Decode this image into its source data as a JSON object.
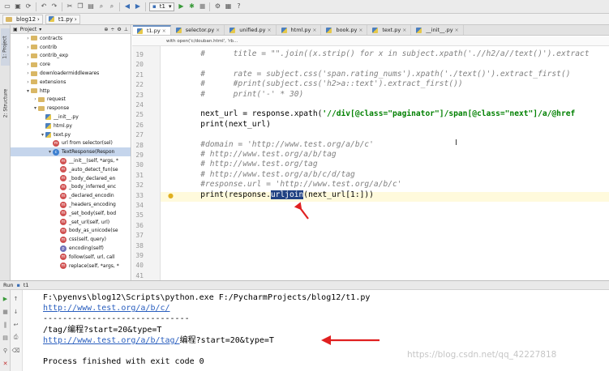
{
  "toolbar": {
    "run_config_label": "t1"
  },
  "navbar": {
    "crumbs": [
      "blog12",
      "t1.py"
    ]
  },
  "left_strip": {
    "project_tab": "1: Project",
    "structure_tab": "2: Structure"
  },
  "project_panel": {
    "title": "Project",
    "items": [
      {
        "label": "contracts",
        "kind": "folder",
        "depth": 2,
        "expanded": false
      },
      {
        "label": "contrib",
        "kind": "folder",
        "depth": 2,
        "expanded": false
      },
      {
        "label": "contrib_exp",
        "kind": "folder",
        "depth": 2,
        "expanded": false
      },
      {
        "label": "core",
        "kind": "folder",
        "depth": 2,
        "expanded": false
      },
      {
        "label": "downloadermiddlewares",
        "kind": "folder",
        "depth": 2,
        "expanded": false
      },
      {
        "label": "extensions",
        "kind": "folder",
        "depth": 2,
        "expanded": false
      },
      {
        "label": "http",
        "kind": "folder",
        "depth": 2,
        "expanded": true
      },
      {
        "label": "request",
        "kind": "folder",
        "depth": 3,
        "expanded": false
      },
      {
        "label": "response",
        "kind": "folder",
        "depth": 3,
        "expanded": true
      },
      {
        "label": "__init__.py",
        "kind": "py",
        "depth": 4
      },
      {
        "label": "html.py",
        "kind": "py",
        "depth": 4
      },
      {
        "label": "text.py",
        "kind": "py",
        "depth": 4,
        "expanded": true
      },
      {
        "label": "url from selector(sel)",
        "kind": "m",
        "depth": 5
      },
      {
        "label": "TextResponse(Respon",
        "kind": "c",
        "depth": 5,
        "expanded": true,
        "selected": true
      },
      {
        "label": "__init__(self, *args, *",
        "kind": "m",
        "depth": 6
      },
      {
        "label": "_auto_detect_fun(se",
        "kind": "m",
        "depth": 6
      },
      {
        "label": "_body_declared_en",
        "kind": "m",
        "depth": 6
      },
      {
        "label": "_body_inferred_enc",
        "kind": "m",
        "depth": 6
      },
      {
        "label": "_declared_encodin",
        "kind": "m",
        "depth": 6
      },
      {
        "label": "_headers_encoding",
        "kind": "m",
        "depth": 6
      },
      {
        "label": "_set_body(self, bod",
        "kind": "m",
        "depth": 6
      },
      {
        "label": "_set_url(self, url)",
        "kind": "m",
        "depth": 6
      },
      {
        "label": "body_as_unicode(se",
        "kind": "m",
        "depth": 6
      },
      {
        "label": "css(self, query)",
        "kind": "m",
        "depth": 6
      },
      {
        "label": "encoding(self)",
        "kind": "p",
        "depth": 6
      },
      {
        "label": "follow(self, url, call",
        "kind": "m",
        "depth": 6
      },
      {
        "label": "replace(self, *args, *",
        "kind": "m",
        "depth": 6
      }
    ]
  },
  "tabs": [
    {
      "label": "t1.py",
      "active": true
    },
    {
      "label": "selector.py",
      "active": false
    },
    {
      "label": "unified.py",
      "active": false
    },
    {
      "label": "html.py",
      "active": false
    },
    {
      "label": "book.py",
      "active": false
    },
    {
      "label": "text.py",
      "active": false
    },
    {
      "label": "__init__.py",
      "active": false
    }
  ],
  "editor": {
    "hint": "with open('c/douban.html', 'rb...",
    "current_line": 33,
    "lines": [
      {
        "num": 19,
        "segments": [
          {
            "t": "        #      title = \"\".join((x.strip() for x in subject.xpath('.//h2/a//text()').extract",
            "c": "cmt"
          }
        ]
      },
      {
        "num": 20,
        "segments": []
      },
      {
        "num": 21,
        "segments": [
          {
            "t": "        #      rate = subject.css('span.rating_nums').xpath('./text()').extract_first()",
            "c": "cmt"
          }
        ]
      },
      {
        "num": 22,
        "segments": [
          {
            "t": "        #      #print(subject.css('h2>a::text').extract_first())",
            "c": "cmt"
          }
        ]
      },
      {
        "num": 23,
        "segments": [
          {
            "t": "        #      print('-' * 30)",
            "c": "cmt"
          }
        ]
      },
      {
        "num": 24,
        "segments": []
      },
      {
        "num": 25,
        "segments": [
          {
            "t": "        next_url = response.xpath(",
            "c": ""
          },
          {
            "t": "'//div[@class=\"paginator\"]/span[@class=\"next\"]/a/@href",
            "c": "str"
          }
        ]
      },
      {
        "num": 26,
        "segments": [
          {
            "t": "        print(next_url)",
            "c": ""
          }
        ]
      },
      {
        "num": 27,
        "segments": []
      },
      {
        "num": 28,
        "segments": [
          {
            "t": "        #domain = 'http://www.test.org/a/b/c'",
            "c": "cmt"
          }
        ]
      },
      {
        "num": 29,
        "segments": [
          {
            "t": "        # http://www.test.org/a/b/tag",
            "c": "cmt"
          }
        ]
      },
      {
        "num": 30,
        "segments": [
          {
            "t": "        # http://www.test.org/tag",
            "c": "cmt"
          }
        ]
      },
      {
        "num": 31,
        "segments": [
          {
            "t": "        # http://www.test.org/a/b/c/d/tag",
            "c": "cmt"
          }
        ]
      },
      {
        "num": 32,
        "segments": [
          {
            "t": "        #response.url = 'http://www.test.org/a/b/c'",
            "c": "cmt"
          }
        ]
      },
      {
        "num": 33,
        "segments": [
          {
            "t": "        print(response.",
            "c": ""
          },
          {
            "t": "urljoin",
            "c": "selw"
          },
          {
            "t": "(next_url[1:]))",
            "c": ""
          }
        ]
      },
      {
        "num": 34,
        "segments": []
      },
      {
        "num": 35,
        "segments": []
      },
      {
        "num": 36,
        "segments": []
      },
      {
        "num": 37,
        "segments": []
      },
      {
        "num": 38,
        "segments": []
      },
      {
        "num": 39,
        "segments": []
      },
      {
        "num": 40,
        "segments": []
      },
      {
        "num": 41,
        "segments": []
      }
    ]
  },
  "run_panel": {
    "label": "Run",
    "config": "t1",
    "output": [
      {
        "segments": [
          {
            "t": "F:\\pyenvs\\blog12\\Scripts\\python.exe F:/PycharmProjects/blog12/t1.py",
            "c": ""
          }
        ]
      },
      {
        "segments": [
          {
            "t": "http://www.test.org/a/b/c/",
            "c": "lnk"
          }
        ]
      },
      {
        "segments": [
          {
            "t": "------------------------------",
            "c": ""
          }
        ]
      },
      {
        "segments": [
          {
            "t": "/tag/编程?start=20&type=T",
            "c": ""
          }
        ]
      },
      {
        "segments": [
          {
            "t": "http://www.test.org/a/b/tag/",
            "c": "lnk"
          },
          {
            "t": "编程?start=20&type=T",
            "c": ""
          }
        ]
      },
      {
        "segments": []
      },
      {
        "segments": [
          {
            "t": "Process finished with exit code 0",
            "c": ""
          }
        ]
      }
    ]
  },
  "watermark": "https://blog.csdn.net/qq_42227818",
  "colors": {
    "annotation_red": "#e02020",
    "selection": "#214283",
    "current_line": "#fffadc"
  }
}
